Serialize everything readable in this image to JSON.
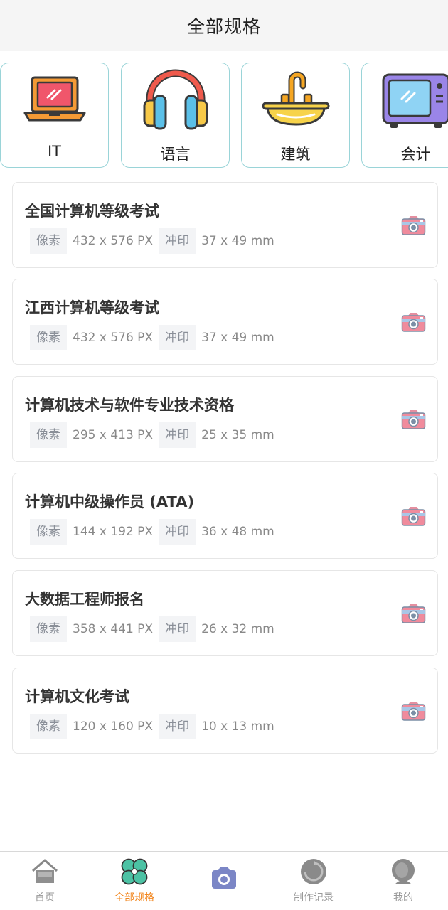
{
  "header": {
    "title": "全部规格"
  },
  "categories": [
    {
      "label": "IT",
      "icon": "laptop-icon"
    },
    {
      "label": "语言",
      "icon": "headphones-icon"
    },
    {
      "label": "建筑",
      "icon": "sink-icon"
    },
    {
      "label": "会计",
      "icon": "tv-icon"
    }
  ],
  "specs": [
    {
      "name": "全国计算机等级考试",
      "pixel_tag": "像素",
      "pixel": "432 x 576 PX",
      "print_tag": "冲印",
      "print": "37 x 49 mm"
    },
    {
      "name": "江西计算机等级考试",
      "pixel_tag": "像素",
      "pixel": "432 x 576 PX",
      "print_tag": "冲印",
      "print": "37 x 49 mm"
    },
    {
      "name": "计算机技术与软件专业技术资格",
      "pixel_tag": "像素",
      "pixel": "295 x 413 PX",
      "print_tag": "冲印",
      "print": "25 x 35 mm"
    },
    {
      "name": "计算机中级操作员 (ATA)",
      "pixel_tag": "像素",
      "pixel": "144 x 192 PX",
      "print_tag": "冲印",
      "print": "36 x 48 mm"
    },
    {
      "name": "大数据工程师报名",
      "pixel_tag": "像素",
      "pixel": "358 x 441 PX",
      "print_tag": "冲印",
      "print": "26 x 32 mm"
    },
    {
      "name": "计算机文化考试",
      "pixel_tag": "像素",
      "pixel": "120 x 160 PX",
      "print_tag": "冲印",
      "print": "10 x 13 mm"
    }
  ],
  "tabbar": [
    {
      "label": "首页",
      "icon": "home-icon",
      "active": false
    },
    {
      "label": "全部规格",
      "icon": "clover-icon",
      "active": true
    },
    {
      "label": "",
      "icon": "camera-icon",
      "active": false
    },
    {
      "label": "制作记录",
      "icon": "history-icon",
      "active": false
    },
    {
      "label": "我的",
      "icon": "user-icon",
      "active": false
    }
  ],
  "colors": {
    "accent": "#f2861e",
    "card_border": "#e6e6e6",
    "category_border": "#9ad4d8",
    "inactive_tab": "#999999"
  }
}
